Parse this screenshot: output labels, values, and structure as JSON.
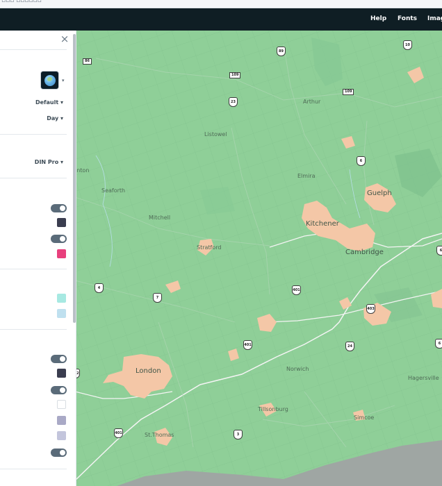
{
  "navbar": {
    "links": [
      {
        "label": "Help"
      },
      {
        "label": "Fonts"
      },
      {
        "label": "Imag"
      }
    ]
  },
  "panel": {
    "close_icon": "×",
    "theme_icon": "globe-icon",
    "dropdown_caret": "▾",
    "style_select": "Default ▾",
    "mode_select": "Day ▾",
    "font_select": "DIN Pro ▾",
    "colors": {
      "dark_slate": "#3a3d4f",
      "pink": "#e8407d",
      "aqua": "#a7e9e2",
      "light_blue": "#bfe0ef",
      "dark_slate_2": "#3a3d4f",
      "white": "#ffffff",
      "lavender": "#a9a9c6",
      "light_lavender": "#c3c5dc"
    }
  },
  "map": {
    "places": [
      {
        "name": "Arthur"
      },
      {
        "name": "Listowel"
      },
      {
        "name": "Elmira"
      },
      {
        "name": "Guelph"
      },
      {
        "name": "Seaforth"
      },
      {
        "name": "inton"
      },
      {
        "name": "Mitchell"
      },
      {
        "name": "Kitchener"
      },
      {
        "name": "Cambridge"
      },
      {
        "name": "Stratford"
      },
      {
        "name": "London"
      },
      {
        "name": "Norwich"
      },
      {
        "name": "Hagersville"
      },
      {
        "name": "Tillsonburg"
      },
      {
        "name": "Simcoe"
      },
      {
        "name": "St.Thomas"
      }
    ],
    "highways": [
      {
        "number": "89"
      },
      {
        "number": "10"
      },
      {
        "number": "86"
      },
      {
        "number": "109"
      },
      {
        "number": "109"
      },
      {
        "number": "23"
      },
      {
        "number": "6"
      },
      {
        "number": "4"
      },
      {
        "number": "7"
      },
      {
        "number": "401"
      },
      {
        "number": "403"
      },
      {
        "number": "401"
      },
      {
        "number": "24"
      },
      {
        "number": "402"
      },
      {
        "number": "6"
      },
      {
        "number": "401"
      },
      {
        "number": "3"
      },
      {
        "number": "6"
      }
    ]
  }
}
